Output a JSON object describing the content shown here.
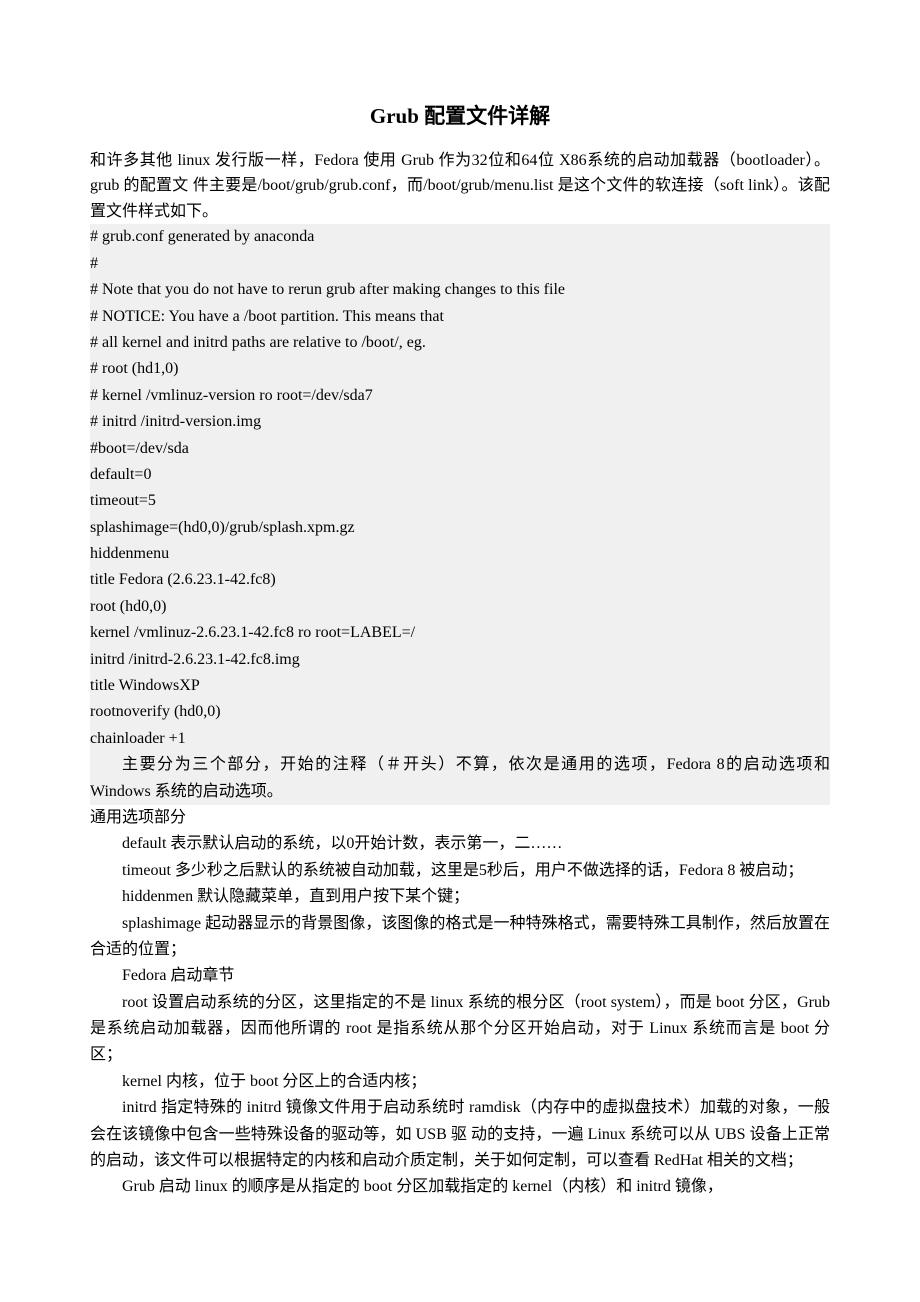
{
  "title": "Grub 配置文件详解",
  "intro": "和许多其他 linux 发行版一样，Fedora 使用 Grub 作为32位和64位 X86系统的启动加载器（bootloader）。grub 的配置文 件主要是/boot/grub/grub.conf，而/boot/grub/menu.list 是这个文件的软连接（soft link）。该配置文件样式如下。",
  "code": [
    "# grub.conf generated by anaconda",
    "#",
    "# Note that you do not have to rerun grub after making changes to this file",
    "# NOTICE: You have a /boot partition. This means that",
    "# all kernel and initrd paths are relative to /boot/, eg.",
    "# root (hd1,0)",
    "# kernel /vmlinuz-version ro root=/dev/sda7",
    "# initrd /initrd-version.img",
    "#boot=/dev/sda",
    "default=0",
    "timeout=5",
    "splashimage=(hd0,0)/grub/splash.xpm.gz",
    "hiddenmenu",
    "title Fedora (2.6.23.1-42.fc8)",
    "root (hd0,0)",
    "kernel /vmlinuz-2.6.23.1-42.fc8 ro root=LABEL=/",
    "initrd /initrd-2.6.23.1-42.fc8.img",
    "title WindowsXP",
    "rootnoverify (hd0,0)",
    "chainloader +1"
  ],
  "summary": "主要分为三个部分，开始的注释（＃开头）不算，依次是通用的选项，Fedora 8的启动选项和 Windows 系统的启动选项。",
  "common_head": "通用选项部分",
  "common_default": "default 表示默认启动的系统，以0开始计数，表示第一，二……",
  "common_timeout": "timeout 多少秒之后默认的系统被自动加载，这里是5秒后，用户不做选择的话，Fedora 8 被启动；",
  "common_hiddenmen": "hiddenmen 默认隐藏菜单，直到用户按下某个键；",
  "common_splash": "splashimage 起动器显示的背景图像，该图像的格式是一种特殊格式，需要特殊工具制作，然后放置在合适的位置；",
  "fedora_head": "Fedora 启动章节",
  "fedora_root": "root 设置启动系统的分区，这里指定的不是 linux 系统的根分区（root system），而是 boot 分区，Grub 是系统启动加载器，因而他所谓的 root 是指系统从那个分区开始启动，对于 Linux 系统而言是 boot 分区；",
  "fedora_kernel": "kernel 内核，位于 boot 分区上的合适内核；",
  "fedora_initrd": "initrd 指定特殊的 initrd 镜像文件用于启动系统时 ramdisk（内存中的虚拟盘技术）加载的对象，一般会在该镜像中包含一些特殊设备的驱动等，如 USB 驱 动的支持，一遍 Linux 系统可以从 UBS 设备上正常的启动，该文件可以根据特定的内核和启动介质定制，关于如何定制，可以查看 RedHat 相关的文档；",
  "fedora_sequence": "Grub 启动 linux 的顺序是从指定的 boot 分区加载指定的 kernel（内核）和 initrd 镜像，"
}
